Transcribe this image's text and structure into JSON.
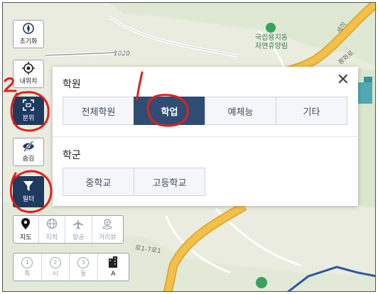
{
  "map": {
    "labels": {
      "park_line1": "국립용지동",
      "park_line2": "자연휴양림",
      "road_number": "1020",
      "road_name": "세직",
      "road_name2": "봉화로",
      "road_bottom": "로1-7로1"
    }
  },
  "left_tools": {
    "reset": {
      "icon": "compass-icon",
      "label": "초기화"
    },
    "my_location": {
      "icon": "location-target-icon",
      "label": "내위치"
    },
    "analysis": {
      "icon": "bracket-frame-icon",
      "label": "분위"
    },
    "hide": {
      "icon": "eye-slash-icon",
      "label": "숨김"
    },
    "filter": {
      "icon": "funnel-icon",
      "label": "필터"
    }
  },
  "map_type_tabs": [
    {
      "icon": "pin-icon",
      "label": "지도",
      "active": true
    },
    {
      "icon": "globe-icon",
      "label": "지적",
      "active": false
    },
    {
      "icon": "airplane-icon",
      "label": "항공",
      "active": false
    },
    {
      "icon": "street-view-icon",
      "label": "거리뷰",
      "active": false
    }
  ],
  "zoom_tabs": [
    {
      "num": "1",
      "label": "특",
      "active": false
    },
    {
      "num": "2",
      "label": "시",
      "active": false
    },
    {
      "num": "3",
      "label": "동",
      "active": false
    },
    {
      "icon": "building-icon",
      "label": "A",
      "active": true
    }
  ],
  "filter_panel": {
    "academy_title": "학원",
    "academy_buttons": [
      {
        "label": "전체학원",
        "active": false
      },
      {
        "label": "학업",
        "active": true
      },
      {
        "label": "예체능",
        "active": false
      },
      {
        "label": "기타",
        "active": false
      }
    ],
    "school_title": "학군",
    "school_buttons": [
      {
        "label": "중학교",
        "active": false
      },
      {
        "label": "고등학교",
        "active": false
      }
    ],
    "close_glyph": "✕"
  },
  "colors": {
    "accent": "#2f4d73",
    "annotation": "#e0201b",
    "road": "#f3c04b"
  }
}
